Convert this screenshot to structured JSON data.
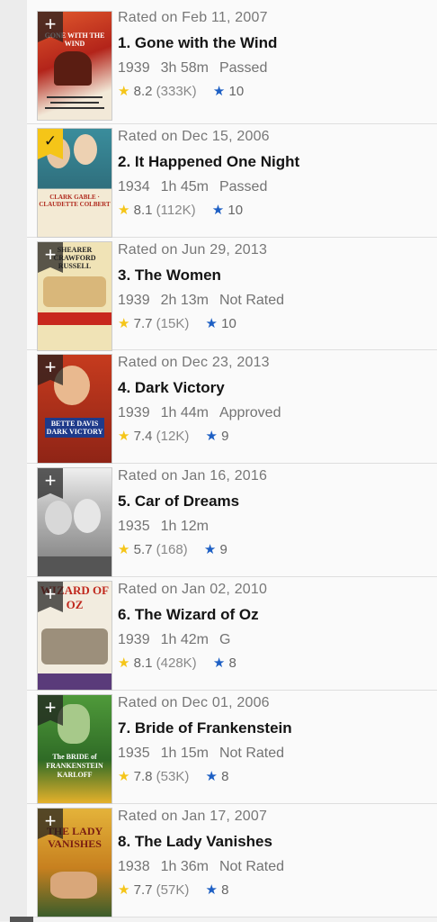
{
  "movies": [
    {
      "rated": "Rated on Feb 11, 2007",
      "title": "1. Gone with the Wind",
      "year": "1939",
      "runtime": "3h 58m",
      "certificate": "Passed",
      "rating": "8.2",
      "votes": "(333K)",
      "user_rating": "10",
      "watched": false,
      "poster_text": "GONE WITH THE WIND",
      "poster_bg": "#c8321f"
    },
    {
      "rated": "Rated on Dec 15, 2006",
      "title": "2. It Happened One Night",
      "year": "1934",
      "runtime": "1h 45m",
      "certificate": "Passed",
      "rating": "8.1",
      "votes": "(112K)",
      "user_rating": "10",
      "watched": true,
      "poster_text": "CLARK GABLE · CLAUDETTE COLBERT",
      "poster_bg": "#2d7b8a"
    },
    {
      "rated": "Rated on Jun 29, 2013",
      "title": "3. The Women",
      "year": "1939",
      "runtime": "2h 13m",
      "certificate": "Not Rated",
      "rating": "7.7",
      "votes": "(15K)",
      "user_rating": "10",
      "watched": false,
      "poster_text": "SHEARER CRAWFORD RUSSELL",
      "poster_bg": "#e8d9a6"
    },
    {
      "rated": "Rated on Dec 23, 2013",
      "title": "4. Dark Victory",
      "year": "1939",
      "runtime": "1h 44m",
      "certificate": "Approved",
      "rating": "7.4",
      "votes": "(12K)",
      "user_rating": "9",
      "watched": false,
      "poster_text": "BETTE DAVIS DARK VICTORY",
      "poster_bg": "#b3361f"
    },
    {
      "rated": "Rated on Jan 16, 2016",
      "title": "5. Car of Dreams",
      "year": "1935",
      "runtime": "1h 12m",
      "certificate": "",
      "rating": "5.7",
      "votes": "(168)",
      "user_rating": "9",
      "watched": false,
      "poster_text": "",
      "poster_bg": "#9a9a9a"
    },
    {
      "rated": "Rated on Jan 02, 2010",
      "title": "6. The Wizard of Oz",
      "year": "1939",
      "runtime": "1h 42m",
      "certificate": "G",
      "rating": "8.1",
      "votes": "(428K)",
      "user_rating": "8",
      "watched": false,
      "poster_text": "WIZARD OF OZ",
      "poster_bg": "#efe6d2"
    },
    {
      "rated": "Rated on Dec 01, 2006",
      "title": "7. Bride of Frankenstein",
      "year": "1935",
      "runtime": "1h 15m",
      "certificate": "Not Rated",
      "rating": "7.8",
      "votes": "(53K)",
      "user_rating": "8",
      "watched": false,
      "poster_text": "The BRIDE of FRANKENSTEIN KARLOFF",
      "poster_bg": "#3f8a36"
    },
    {
      "rated": "Rated on Jan 17, 2007",
      "title": "8. The Lady Vanishes",
      "year": "1938",
      "runtime": "1h 36m",
      "certificate": "Not Rated",
      "rating": "7.7",
      "votes": "(57K)",
      "user_rating": "8",
      "watched": false,
      "poster_text": "THE LADY VANISHES",
      "poster_bg": "#e0a22a"
    }
  ],
  "icons": {
    "add": "plus-icon",
    "watched": "checkmark-icon",
    "imdb_star": "star-icon",
    "user_star": "star-icon"
  },
  "colors": {
    "gold": "#f5c518",
    "blue": "#1d5fc4"
  }
}
